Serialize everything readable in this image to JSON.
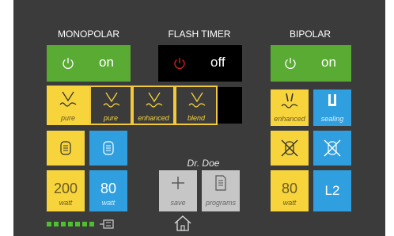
{
  "headers": {
    "monopolar": "MONOPOLAR",
    "flash_timer": "FLASH TIMER",
    "bipolar": "BIPOLAR"
  },
  "monopolar": {
    "power_state": "on",
    "modes": [
      {
        "label": "pure",
        "selected": true
      },
      {
        "label": "pure",
        "selected": true
      },
      {
        "label": "enhanced",
        "selected": true
      },
      {
        "label": "blend",
        "selected": true
      }
    ],
    "cut_power": {
      "value": "200",
      "unit": "watt"
    },
    "coag_power": {
      "value": "80",
      "unit": "watt"
    }
  },
  "flash_timer": {
    "state": "off"
  },
  "bipolar": {
    "power_state": "on",
    "modes": [
      {
        "label": "enhanced"
      },
      {
        "label": "sealing"
      }
    ],
    "power": {
      "value": "80",
      "unit": "watt"
    },
    "level": "L2"
  },
  "user": {
    "name": "Dr. Doe",
    "save_label": "save",
    "programs_label": "programs"
  },
  "status": {
    "level_dots": 7
  },
  "colors": {
    "green": "#5aab33",
    "yellow": "#f7d43c",
    "blue": "#2f9fe0",
    "panel": "#3b3b3b",
    "power_red": "#e02020"
  },
  "icons": [
    "power-icon",
    "cut-waveform-icon",
    "coag-waveform-icon",
    "pedal-icon",
    "disabled-pedal-icon",
    "plus-icon",
    "document-icon",
    "home-icon",
    "plug-icon"
  ]
}
